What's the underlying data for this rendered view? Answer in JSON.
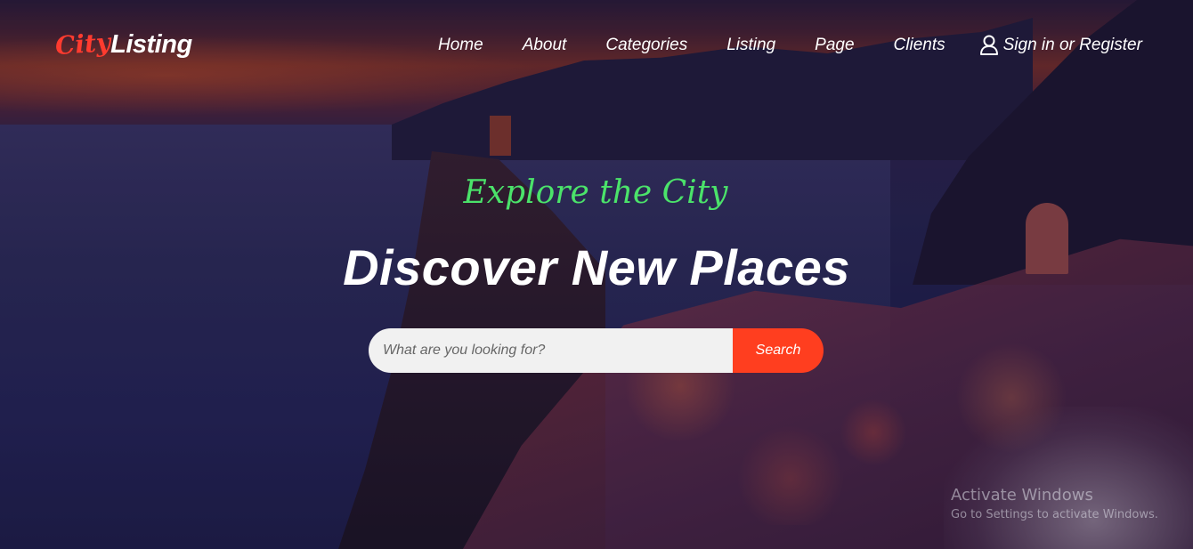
{
  "brand": {
    "logo_part1": "City",
    "logo_part2": "Listing",
    "accent_color": "#ff3b2f"
  },
  "nav": {
    "items": [
      {
        "label": "Home"
      },
      {
        "label": "About"
      },
      {
        "label": "Categories"
      },
      {
        "label": "Listing"
      },
      {
        "label": "Page"
      },
      {
        "label": "Clients"
      }
    ],
    "signin": {
      "label": "Sign in or Register",
      "icon": "user-icon"
    }
  },
  "hero": {
    "tagline": "Explore the City",
    "tagline_color": "#4be36a",
    "headline": "Discover New Places"
  },
  "search": {
    "placeholder": "What are you looking for?",
    "button_label": "Search",
    "button_color": "#ff3e1f"
  },
  "watermark": {
    "title": "Activate Windows",
    "subtitle": "Go to Settings to activate Windows."
  }
}
